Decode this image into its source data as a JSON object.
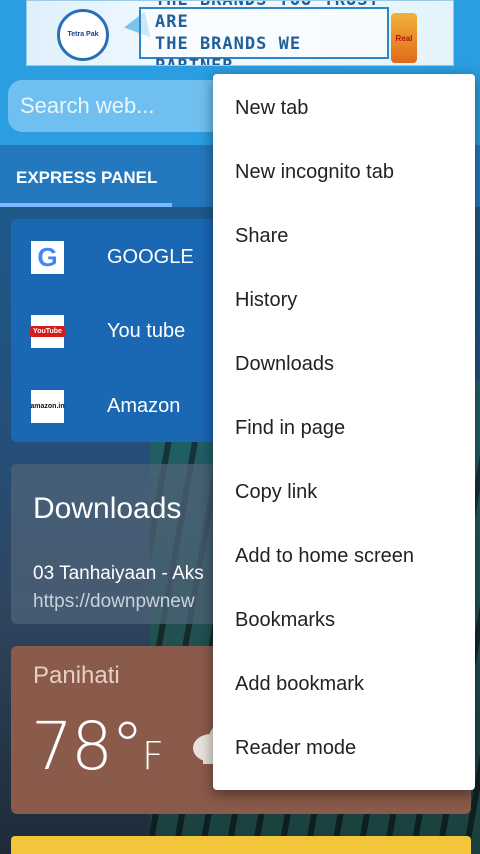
{
  "ad": {
    "line1": "THE BRANDS YOU TRUST ARE",
    "line2": "THE BRANDS WE PARTNER",
    "logo_text": "Tetra Pak",
    "product_text": "Real",
    "info_icon": "info-icon"
  },
  "search": {
    "placeholder": "Search web..."
  },
  "express_panel": {
    "tab_label": "EXPRESS PANEL",
    "links": [
      {
        "label": "GOOGLE",
        "icon": "google-icon",
        "icon_text": "G"
      },
      {
        "label": "You tube",
        "icon": "youtube-icon",
        "icon_text": "YouTube"
      },
      {
        "label": "Amazon",
        "icon": "amazon-icon",
        "icon_text": "amazon.in"
      }
    ]
  },
  "downloads": {
    "title": "Downloads",
    "file_name": "03 Tanhaiyaan - Aks",
    "url": "https://downpwnew"
  },
  "weather": {
    "city": "Panihati",
    "temperature": "78°",
    "unit": "F",
    "icon": "cloud-icon"
  },
  "menu": {
    "items": [
      "New tab",
      "New incognito tab",
      "Share",
      "History",
      "Downloads",
      "Find in page",
      "Copy link",
      "Add to home screen",
      "Bookmarks",
      "Add bookmark",
      "Reader mode"
    ]
  },
  "colors": {
    "header_blue": "#2a9ee0",
    "panel_blue": "#1a67b4",
    "weather_brown": "#8a5a4a",
    "accent_yellow": "#f2c53a"
  }
}
